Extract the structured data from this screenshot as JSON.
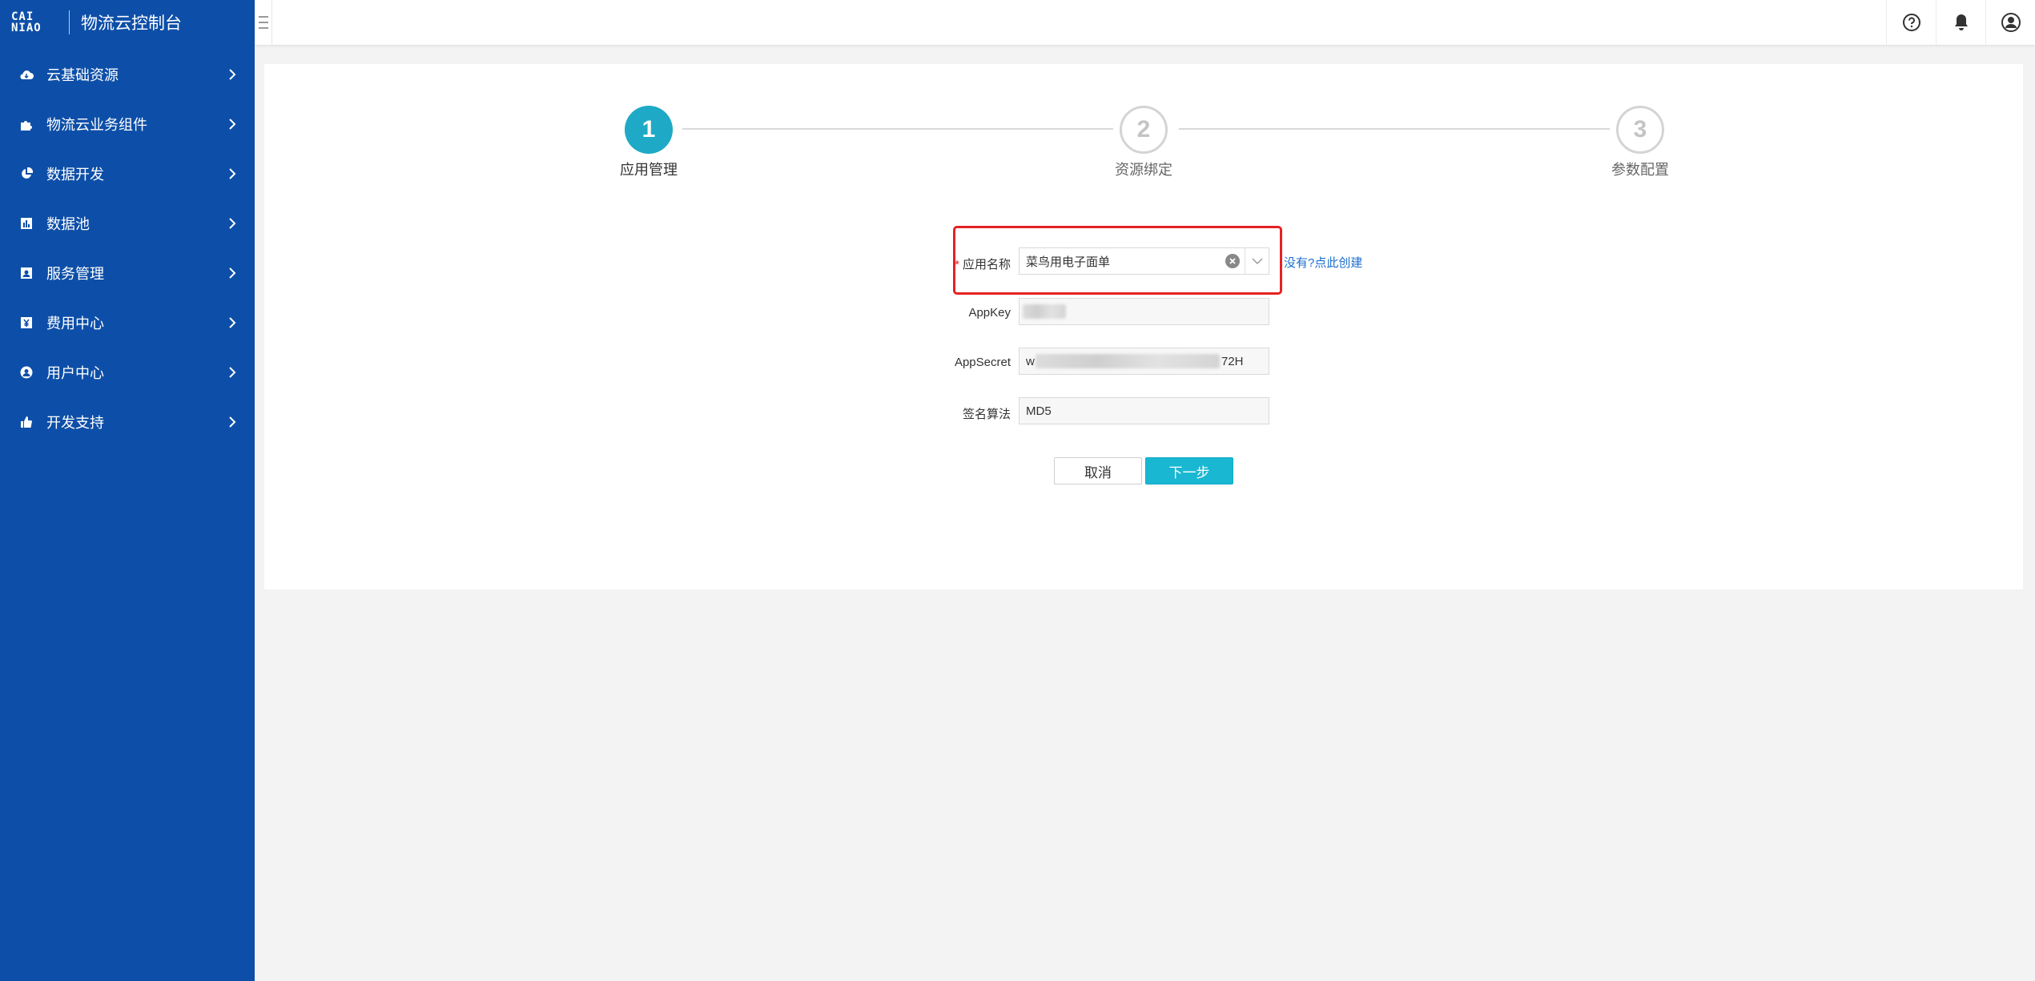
{
  "sidebar": {
    "logo_line1": "CAI",
    "logo_line2": "NIAO",
    "title": "物流云控制台",
    "items": [
      {
        "label": "云基础资源",
        "icon": "cloud-icon"
      },
      {
        "label": "物流云业务组件",
        "icon": "puzzle-icon"
      },
      {
        "label": "数据开发",
        "icon": "pie-chart-icon"
      },
      {
        "label": "数据池",
        "icon": "bar-chart-icon"
      },
      {
        "label": "服务管理",
        "icon": "id-card-icon"
      },
      {
        "label": "费用中心",
        "icon": "yen-icon"
      },
      {
        "label": "用户中心",
        "icon": "user-circle-icon"
      },
      {
        "label": "开发支持",
        "icon": "thumbs-up-icon"
      }
    ]
  },
  "topbar": {
    "icons": [
      "help-icon",
      "bell-icon",
      "user-icon"
    ]
  },
  "steps": [
    {
      "number": "1",
      "label": "应用管理",
      "state": "active"
    },
    {
      "number": "2",
      "label": "资源绑定",
      "state": "todo"
    },
    {
      "number": "3",
      "label": "参数配置",
      "state": "todo"
    }
  ],
  "form": {
    "app_name": {
      "label": "应用名称",
      "required_mark": "*",
      "value": "菜鸟用电子面单"
    },
    "app_key": {
      "label": "AppKey",
      "value": ""
    },
    "app_secret": {
      "label": "AppSecret",
      "value_prefix": "w",
      "value_suffix": "72H"
    },
    "sign_method": {
      "label": "签名算法",
      "value": "MD5"
    },
    "create_link": "没有?点此创建",
    "cancel_label": "取消",
    "next_label": "下一步"
  },
  "colors": {
    "sidebar_bg": "#0d4fa8",
    "accent": "#1eaac6",
    "highlight": "#e52222",
    "link": "#1a6fd0"
  }
}
